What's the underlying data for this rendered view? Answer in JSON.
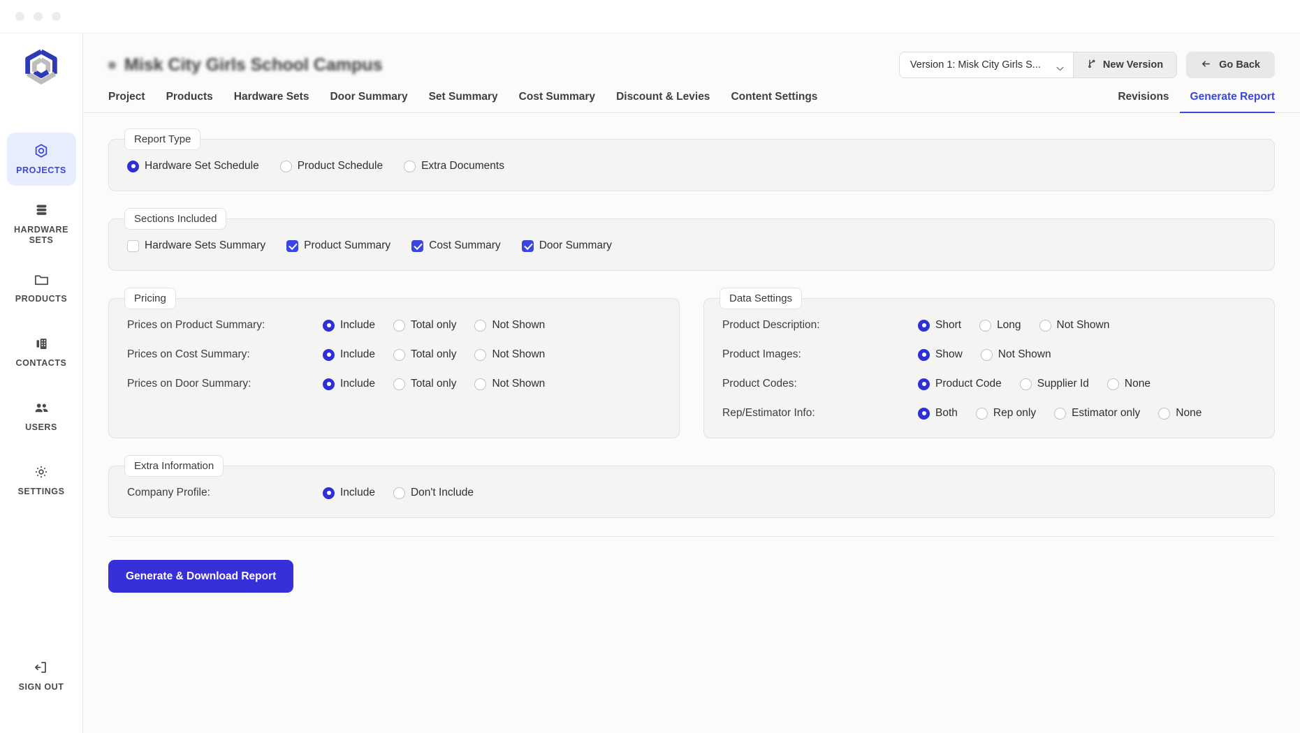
{
  "window": {
    "dots": 3
  },
  "sidebar": {
    "logo_icon": "hexagon-loop-logo",
    "items": [
      {
        "label": "PROJECTS",
        "icon": "target-hexagon-icon",
        "active": true
      },
      {
        "label": "HARDWARE\nSETS",
        "icon": "stacked-layers-icon",
        "active": false
      },
      {
        "label": "PRODUCTS",
        "icon": "folder-icon",
        "active": false
      },
      {
        "label": "CONTACTS",
        "icon": "building-icon",
        "active": false
      },
      {
        "label": "USERS",
        "icon": "users-group-icon",
        "active": false
      },
      {
        "label": "SETTINGS",
        "icon": "gear-icon",
        "active": false
      }
    ],
    "signout": {
      "label": "SIGN OUT",
      "icon": "sign-out-icon"
    }
  },
  "header": {
    "project_title": "Misk City Girls School Campus",
    "version_value": "Version 1: Misk City Girls S...",
    "new_version_label": "New Version",
    "go_back_label": "Go Back"
  },
  "tabs": {
    "left": [
      "Project",
      "Products",
      "Hardware Sets",
      "Door Summary",
      "Set Summary",
      "Cost Summary",
      "Discount & Levies",
      "Content Settings"
    ],
    "right": [
      "Revisions",
      "Generate Report"
    ],
    "active": "Generate Report"
  },
  "report_type": {
    "legend": "Report Type",
    "options": [
      {
        "label": "Hardware Set Schedule",
        "selected": true
      },
      {
        "label": "Product Schedule",
        "selected": false
      },
      {
        "label": "Extra Documents",
        "selected": false
      }
    ]
  },
  "sections_included": {
    "legend": "Sections Included",
    "options": [
      {
        "label": "Hardware Sets Summary",
        "checked": false
      },
      {
        "label": "Product Summary",
        "checked": true
      },
      {
        "label": "Cost Summary",
        "checked": true
      },
      {
        "label": "Door Summary",
        "checked": true
      }
    ]
  },
  "pricing": {
    "legend": "Pricing",
    "rows": [
      {
        "label": "Prices on Product Summary:",
        "options": [
          {
            "label": "Include",
            "selected": true
          },
          {
            "label": "Total only",
            "selected": false
          },
          {
            "label": "Not Shown",
            "selected": false
          }
        ]
      },
      {
        "label": "Prices on Cost Summary:",
        "options": [
          {
            "label": "Include",
            "selected": true
          },
          {
            "label": "Total only",
            "selected": false
          },
          {
            "label": "Not Shown",
            "selected": false
          }
        ]
      },
      {
        "label": "Prices on Door Summary:",
        "options": [
          {
            "label": "Include",
            "selected": true
          },
          {
            "label": "Total only",
            "selected": false
          },
          {
            "label": "Not Shown",
            "selected": false
          }
        ]
      }
    ]
  },
  "data_settings": {
    "legend": "Data Settings",
    "rows": [
      {
        "label": "Product Description:",
        "options": [
          {
            "label": "Short",
            "selected": true
          },
          {
            "label": "Long",
            "selected": false
          },
          {
            "label": "Not Shown",
            "selected": false
          }
        ]
      },
      {
        "label": "Product Images:",
        "options": [
          {
            "label": "Show",
            "selected": true
          },
          {
            "label": "Not Shown",
            "selected": false
          }
        ]
      },
      {
        "label": "Product Codes:",
        "options": [
          {
            "label": "Product Code",
            "selected": true
          },
          {
            "label": "Supplier Id",
            "selected": false
          },
          {
            "label": "None",
            "selected": false
          }
        ]
      },
      {
        "label": "Rep/Estimator Info:",
        "options": [
          {
            "label": "Both",
            "selected": true
          },
          {
            "label": "Rep only",
            "selected": false
          },
          {
            "label": "Estimator only",
            "selected": false
          },
          {
            "label": "None",
            "selected": false
          }
        ]
      }
    ]
  },
  "extra_information": {
    "legend": "Extra Information",
    "rows": [
      {
        "label": "Company Profile:",
        "options": [
          {
            "label": "Include",
            "selected": true
          },
          {
            "label": "Don't Include",
            "selected": false
          }
        ]
      }
    ]
  },
  "generate_button": {
    "label": "Generate & Download Report"
  },
  "colors": {
    "accent": "#3b46e0",
    "radio_selected": "#2f2fd6",
    "button": "#3730d8",
    "panel_bg": "#f4f4f2",
    "page_bg": "#fbfbfa"
  }
}
